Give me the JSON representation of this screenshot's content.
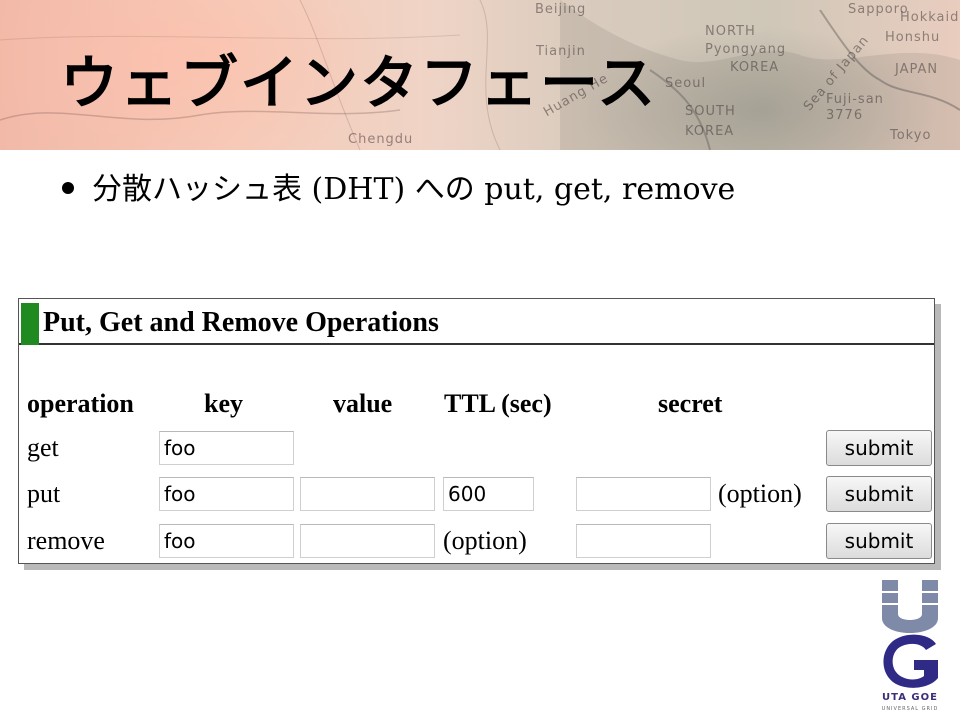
{
  "slide": {
    "title": "ウェブインタフェース",
    "bullet": "分散ハッシュ表 (DHT) への put, get, remove"
  },
  "banner_map_labels": [
    "Beijing",
    "Tianjin",
    "NORTH",
    "Pyongyang",
    "KOREA",
    "Seoul",
    "SOUTH",
    "KOREA",
    "JAPAN",
    "Honshu",
    "Sapporo",
    "Hokkaido",
    "Tokyo",
    "Fuji-san",
    "3776",
    "Sea of Japan",
    "Chengdu",
    "Huang He"
  ],
  "form": {
    "title": "Put, Get and Remove Operations",
    "accent_color": "#1f8a1f",
    "columns": [
      "operation",
      "key",
      "value",
      "TTL (sec)",
      "secret"
    ],
    "rows": [
      {
        "operation": "get",
        "key": "foo",
        "button": "submit"
      },
      {
        "operation": "put",
        "key": "foo",
        "value": "",
        "ttl": "600",
        "secret": "",
        "secret_note": "(option)",
        "button": "submit"
      },
      {
        "operation": "remove",
        "key": "foo",
        "value": "",
        "ttl_note": "(option)",
        "secret": "",
        "button": "submit"
      }
    ]
  },
  "logo": {
    "letters": "UG",
    "caption": "UTA GOE",
    "subcaption": "UNIVERSAL GRID",
    "colors": {
      "top": "#7f8aa8",
      "bottom": "#2f2a86"
    }
  }
}
